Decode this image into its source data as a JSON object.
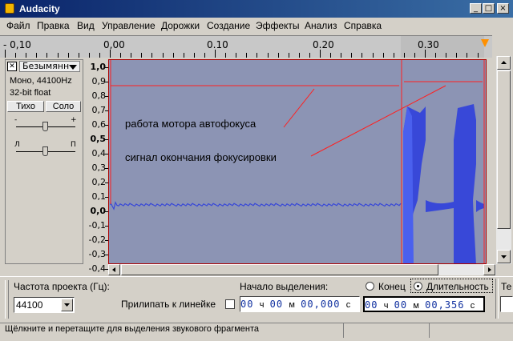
{
  "window": {
    "title": "Audacity"
  },
  "menu": [
    "Файл",
    "Правка",
    "Вид",
    "Управление",
    "Дорожки",
    "Создание",
    "Эффекты",
    "Анализ",
    "Справка"
  ],
  "ruler": {
    "labels": [
      "- 0,10",
      "0,00",
      "0.10",
      "0.20",
      "0.30"
    ]
  },
  "track": {
    "name": "Безымянн",
    "info1": "Моно, 44100Hz",
    "info2": "32-bit float",
    "mute_label": "Тихо",
    "solo_label": "Соло",
    "gain_minus": "-",
    "gain_plus": "+",
    "pan_left": "Л",
    "pan_right": "П"
  },
  "vruler": {
    "labels": [
      "1,0",
      "0,9",
      "0,8",
      "0,7",
      "0,6",
      "0,5",
      "0,4",
      "0,3",
      "0,2",
      "0,1",
      "0,0",
      "-0,1",
      "-0,2",
      "-0,3",
      "-0,4"
    ]
  },
  "annotations": {
    "text1": "работа мотора автофокуса",
    "text2": "сигнал окончания фокусировки",
    "color": "#ff2020"
  },
  "selection_toolbar": {
    "project_rate_label": "Частота проекта (Гц):",
    "project_rate_value": "44100",
    "snap_label": "Прилипать к линейке",
    "start_label": "Начало выделения:",
    "end_label": "Конец",
    "length_label": "Длительность",
    "cut_label": "Те",
    "start_time": {
      "h": "00",
      "h_unit": "ч",
      "m": "00",
      "m_unit": "м",
      "s": "00,000",
      "s_unit": "с"
    },
    "length_time": {
      "h": "00",
      "h_unit": "ч",
      "m": "00",
      "m_unit": "м",
      "s": "00,356",
      "s_unit": "с"
    }
  },
  "status": {
    "text": "Щёлкните и перетащите для выделения звукового фрагмента"
  },
  "colors": {
    "waveform_bg": "#8c94b4",
    "waveform": "#3848d8",
    "title_bar": "#0a246a"
  }
}
